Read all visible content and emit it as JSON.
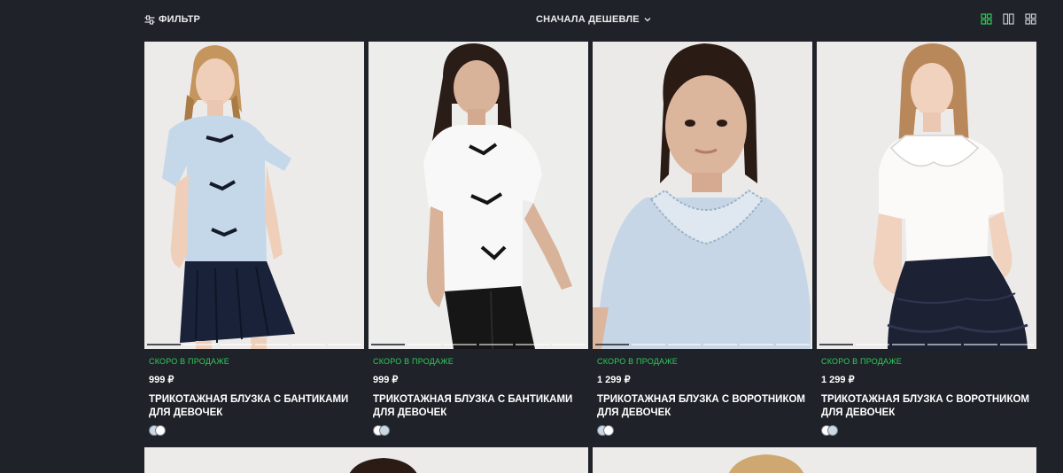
{
  "toolbar": {
    "filter_label": "ФИЛЬТР",
    "filter_icon": "sliders-icon",
    "sort_label": "СНАЧАЛА ДЕШЕВЛЕ",
    "sort_icon": "chevron-down-icon",
    "view_modes": [
      {
        "icon": "grid-2x2-icon",
        "active": true
      },
      {
        "icon": "grid-2-columns-icon",
        "active": false
      },
      {
        "icon": "grid-4-icon",
        "active": false
      }
    ]
  },
  "colors": {
    "background": "#1f2228",
    "accent": "#2ecc5b",
    "card_bg": "#ecebe9"
  },
  "products": [
    {
      "badge": "СКОРО В ПРОДАЖЕ",
      "price": "999 ₽",
      "title": "ТРИКОТАЖНАЯ БЛУЗКА С БАНТИКАМИ ДЛЯ ДЕВОЧЕК",
      "image": "girl-light-blue-blouse-bows-navy-skirt",
      "swatches": [
        "#c9d9e6",
        "#ffffff"
      ]
    },
    {
      "badge": "СКОРО В ПРОДАЖЕ",
      "price": "999 ₽",
      "title": "ТРИКОТАЖНАЯ БЛУЗКА С БАНТИКАМИ ДЛЯ ДЕВОЧЕК",
      "image": "girl-white-blouse-bows-black-trousers",
      "swatches": [
        "#ffffff",
        "#c9d9e6"
      ]
    },
    {
      "badge": "СКОРО В ПРОДАЖЕ",
      "price": "1 299 ₽",
      "title": "ТРИКОТАЖНАЯ БЛУЗКА С ВОРОТНИКОМ ДЛЯ ДЕВОЧЕК",
      "image": "girl-light-blue-blouse-lace-collar",
      "swatches": [
        "#c9d9e6",
        "#ffffff"
      ]
    },
    {
      "badge": "СКОРО В ПРОДАЖЕ",
      "price": "1 299 ₽",
      "title": "ТРИКОТАЖНАЯ БЛУЗКА С ВОРОТНИКОМ ДЛЯ ДЕВОЧЕК",
      "image": "girl-white-blouse-collar-navy-ruffle-skirt",
      "swatches": [
        "#ffffff",
        "#c9d9e6"
      ]
    }
  ]
}
